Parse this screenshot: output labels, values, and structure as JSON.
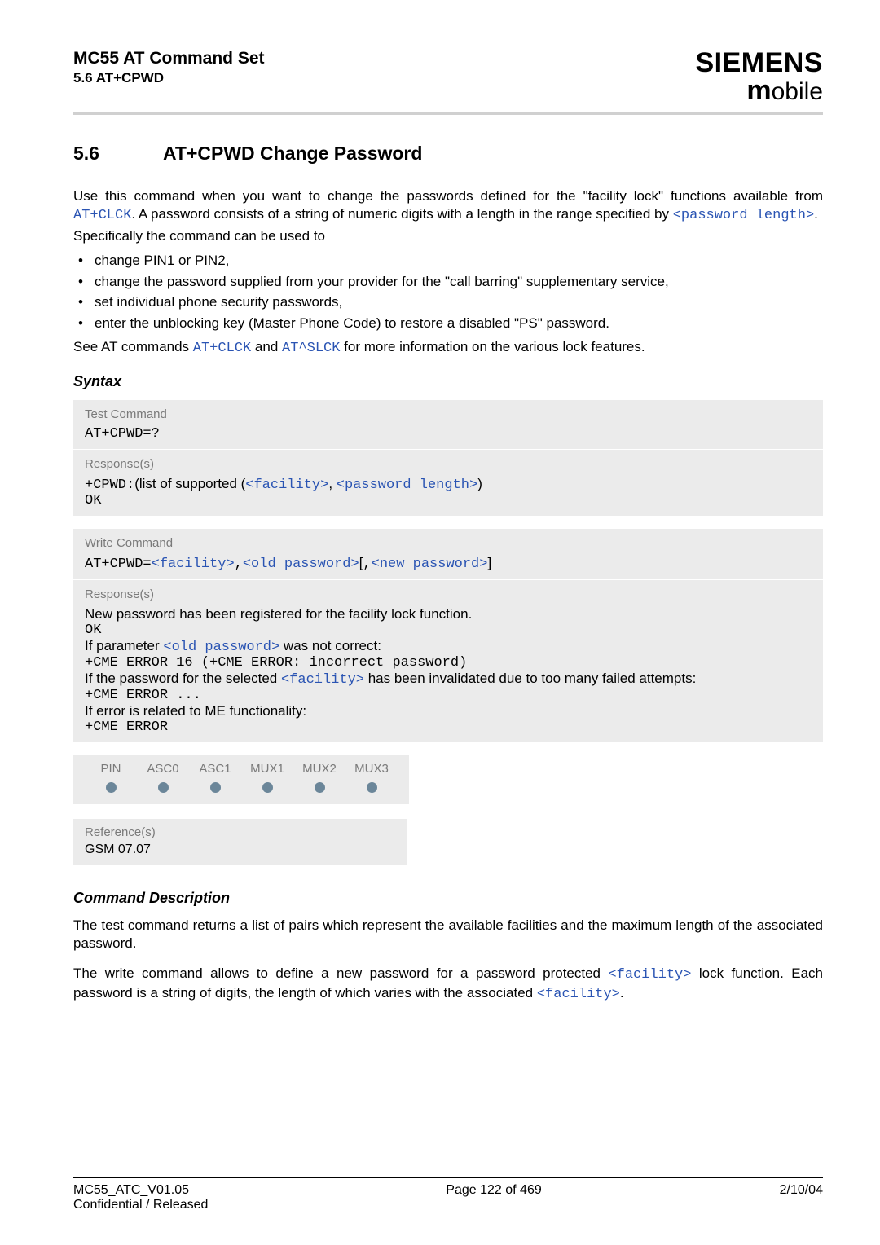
{
  "header": {
    "title": "MC55 AT Command Set",
    "subtitle": "5.6 AT+CPWD",
    "logo_top": "SIEMENS",
    "logo_bottom_m": "m",
    "logo_bottom_rest": "obile"
  },
  "section": {
    "number": "5.6",
    "title": "AT+CPWD   Change Password"
  },
  "intro": {
    "p1a": "Use this command when you want to change the passwords defined for the \"facility lock\" functions available from ",
    "p1_link1": "AT+CLCK",
    "p1b": ". A password consists of a string of numeric digits with a length in the range specified by ",
    "p1_link2": "<password length>",
    "p1c": ".",
    "p2": "Specifically the command can be used to",
    "bullets": [
      "change PIN1 or PIN2,",
      "change the password supplied from your provider for the \"call barring\" supplementary service,",
      "set individual phone security passwords,",
      "enter the unblocking key (Master Phone Code) to restore a disabled \"PS\" password."
    ],
    "p3a": "See AT commands ",
    "p3_link1": "AT+CLCK",
    "p3b": " and ",
    "p3_link2": "AT^SLCK",
    "p3c": " for more information on the various lock features."
  },
  "syntax_heading": "Syntax",
  "box1": {
    "label1": "Test Command",
    "cmd1": "AT+CPWD=?",
    "label2": "Response(s)",
    "resp_prefix": "+CPWD:",
    "resp_mid": "(list of supported (",
    "resp_fac": "<facility>",
    "resp_comma": ", ",
    "resp_pwlen": "<password length>",
    "resp_close": ")",
    "ok": "OK"
  },
  "box2": {
    "label1": "Write Command",
    "cmd_prefix": "AT+CPWD=",
    "fac": "<facility>",
    "c1": ",",
    "oldpw": "<old password>",
    "br1": "[",
    "c2": ",",
    "newpw": "<new password>",
    "br2": "]",
    "label2": "Response(s)",
    "r1": "New password has been registered for the facility lock function.",
    "r2": "OK",
    "r3a": "If parameter ",
    "r3_link": "<old password>",
    "r3b": " was not correct:",
    "r4": "+CME ERROR 16 (+CME ERROR: incorrect password)",
    "r5a": "If the password for the selected ",
    "r5_link": "<facility>",
    "r5b": " has been invalidated due to too many failed attempts:",
    "r6": "+CME ERROR ...",
    "r7": "If error is related to ME functionality:",
    "r8": "+CME ERROR"
  },
  "pins": {
    "headers": [
      "PIN",
      "ASC0",
      "ASC1",
      "MUX1",
      "MUX2",
      "MUX3"
    ]
  },
  "references": {
    "label": "Reference(s)",
    "value": "GSM 07.07"
  },
  "cmd_desc_heading": "Command Description",
  "cmd_desc": {
    "p1": "The test command returns a list of pairs which represent the available facilities and the maximum length of the associated password.",
    "p2a": "The write command allows to define a new password for a password protected ",
    "p2_link1": "<facility>",
    "p2b": " lock function. Each password is a string of digits, the length of which varies with the associated ",
    "p2_link2": "<facility>",
    "p2c": "."
  },
  "footer": {
    "left1": "MC55_ATC_V01.05",
    "left2": "Confidential / Released",
    "center": "Page 122 of 469",
    "right": "2/10/04"
  }
}
